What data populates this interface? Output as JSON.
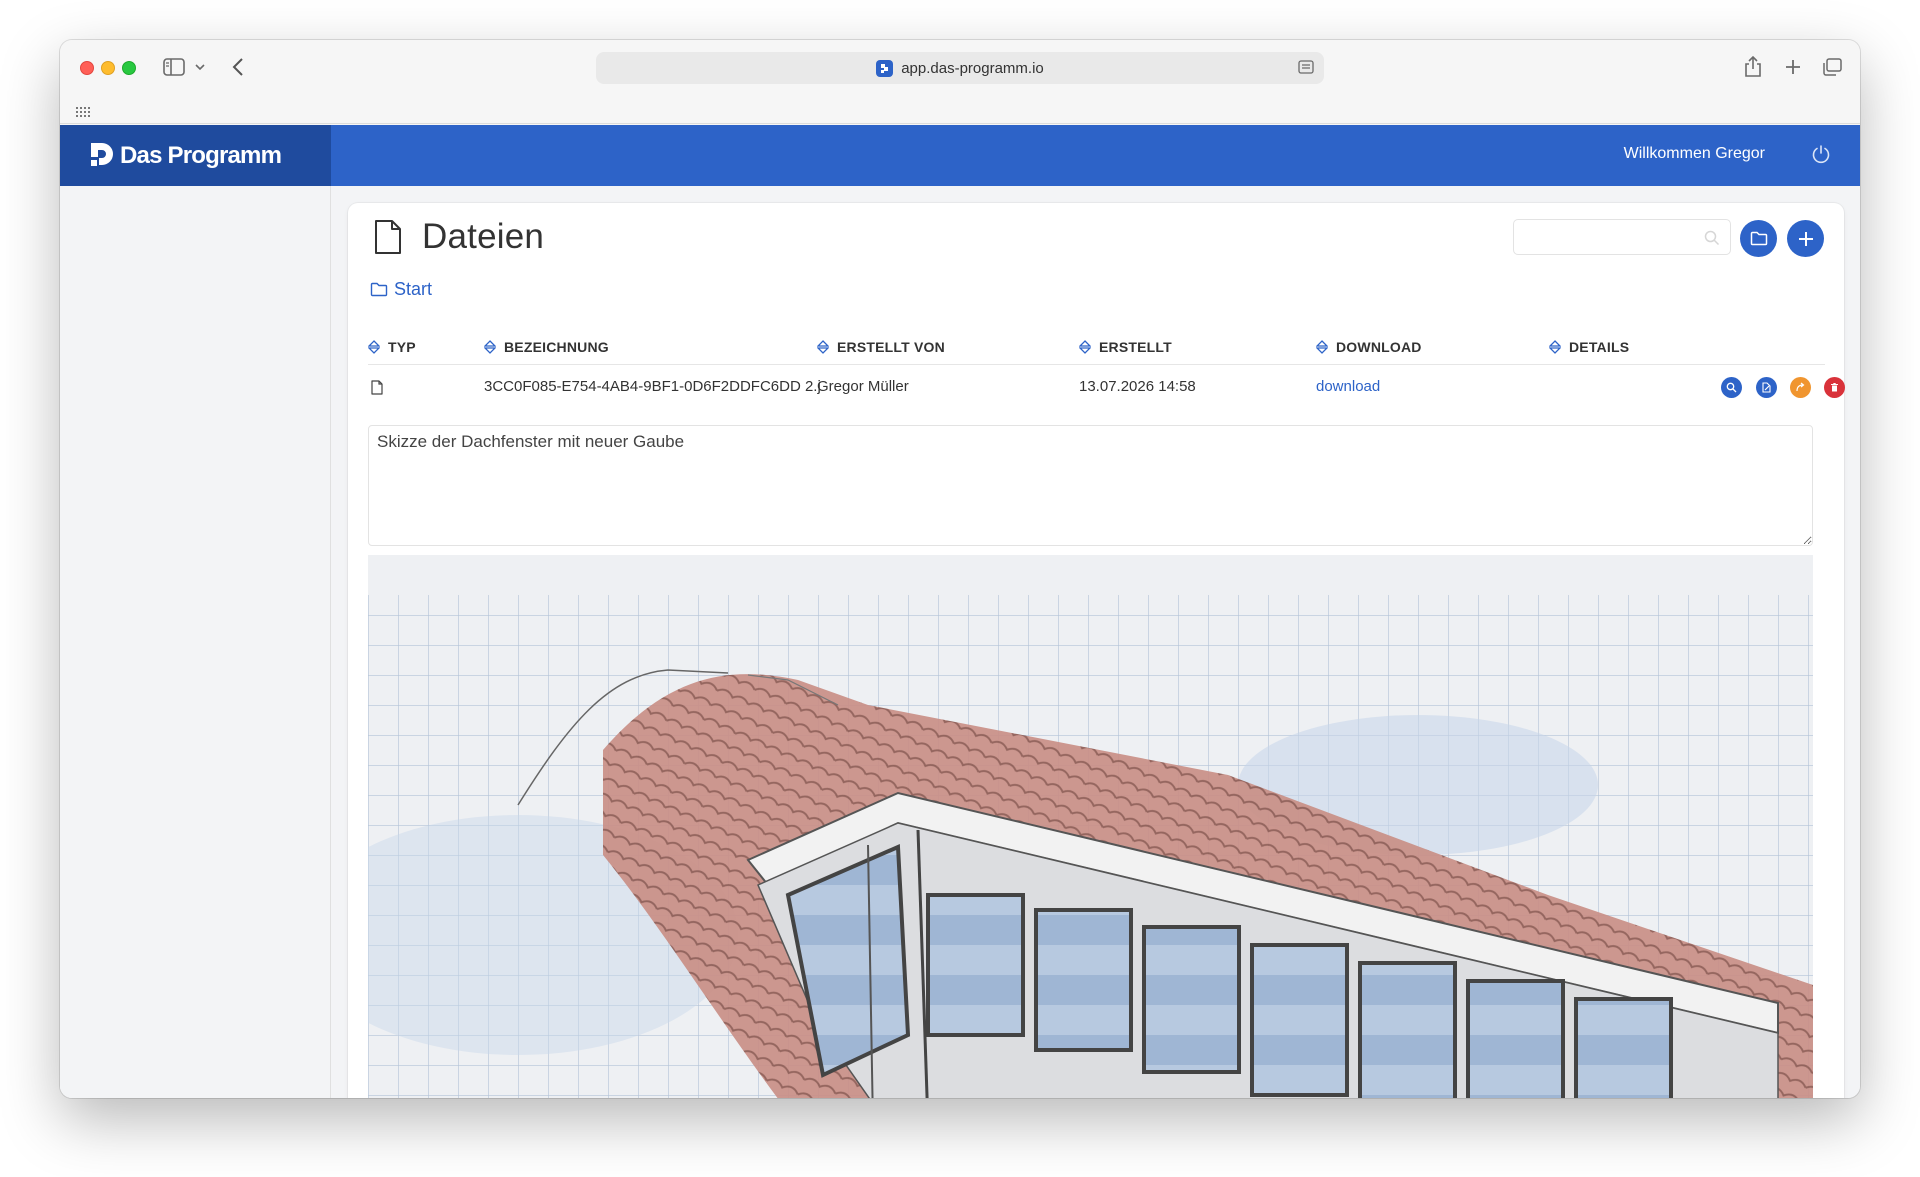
{
  "browser": {
    "url": "app.das-programm.io"
  },
  "app": {
    "brand": "Das Programm",
    "welcome": "Willkommen Gregor"
  },
  "page": {
    "title": "Dateien",
    "breadcrumb": "Start",
    "search_placeholder": ""
  },
  "table": {
    "headers": {
      "typ": "TYP",
      "bezeichnung": "BEZEICHNUNG",
      "erstellt_von": "ERSTELLT VON",
      "erstellt": "ERSTELLT",
      "download": "DOWNLOAD",
      "details": "DETAILS"
    },
    "row": {
      "type_icon": "file-icon",
      "bezeichnung": "3CC0F085-E754-4AB4-9BF1-0D6F2DDFC6DD 2.j",
      "erstellt_von": "Gregor Müller",
      "erstellt": "13.07.2026 14:58",
      "download": "download",
      "actions": [
        "search-icon",
        "edit-icon",
        "share-icon",
        "trash-icon"
      ]
    }
  },
  "file": {
    "description": "Skizze der Dachfenster mit neuer Gaube"
  },
  "colors": {
    "primary": "#2d63c8",
    "brand_dark": "#1f4b9e",
    "warning": "#f0952f",
    "danger": "#d9323a"
  }
}
